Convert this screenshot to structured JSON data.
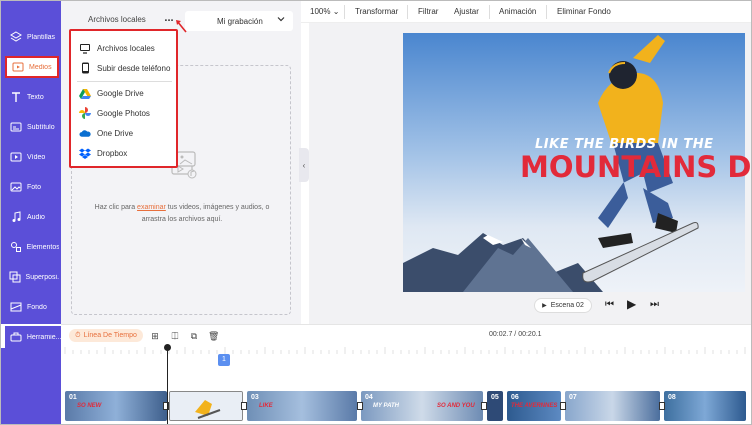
{
  "sidebar": {
    "items": [
      {
        "label": "Plantillas",
        "icon": "layers-icon"
      },
      {
        "label": "Medios",
        "icon": "media-folder-icon",
        "active": true
      },
      {
        "label": "Texto",
        "icon": "text-icon"
      },
      {
        "label": "Subtítulo",
        "icon": "subtitle-icon"
      },
      {
        "label": "Vídeo",
        "icon": "video-icon"
      },
      {
        "label": "Foto",
        "icon": "photo-icon"
      },
      {
        "label": "Audio",
        "icon": "music-icon"
      },
      {
        "label": "Elementos",
        "icon": "elements-icon"
      },
      {
        "label": "Superposi...",
        "icon": "overlay-icon"
      },
      {
        "label": "Fondo",
        "icon": "background-icon"
      },
      {
        "label": "Herramie...",
        "icon": "toolbox-icon"
      }
    ]
  },
  "panel": {
    "tab_label": "Archivos locales",
    "more_label": "...",
    "recording_select": "Mi grabación",
    "drop_text_before": "Haz clic para ",
    "drop_link": "examinar",
    "drop_text_after": " tus videos, imágenes y audios, o arrastra los archivos aquí."
  },
  "upload_menu": {
    "items": [
      {
        "label": "Archivos locales",
        "icon": "monitor-icon"
      },
      {
        "label": "Subir desde teléfono",
        "icon": "phone-icon"
      },
      {
        "label": "Google Drive",
        "icon": "google-drive-icon"
      },
      {
        "label": "Google Photos",
        "icon": "google-photos-icon"
      },
      {
        "label": "One Drive",
        "icon": "onedrive-icon"
      },
      {
        "label": "Dropbox",
        "icon": "dropbox-icon"
      }
    ]
  },
  "toolbar": {
    "zoom": "100%",
    "transform": "Transformar",
    "filter": "Filtrar",
    "adjust": "Ajustar",
    "animation": "Animación",
    "remove_bg": "Eliminar Fondo"
  },
  "preview": {
    "overlay_line1": "LIKE THE BIRDS IN THE",
    "overlay_line2": "MOUNTAINS DO",
    "scene_label": "Escena 02"
  },
  "timeline": {
    "label": "Línea De Tiempo",
    "time": "00:02.7 / 00:20.1",
    "marker": "1",
    "clips": [
      {
        "num": "01",
        "text": "SO NEW"
      },
      {
        "num": "02",
        "text": ""
      },
      {
        "num": "03",
        "text": "LIKE"
      },
      {
        "num": "04",
        "text": "MY PATH"
      },
      {
        "num": "05",
        "text": "SO AND YOU"
      },
      {
        "num": "06",
        "text": "THE AVERNNES"
      },
      {
        "num": "07",
        "text": ""
      },
      {
        "num": "08",
        "text": ""
      }
    ]
  },
  "colors": {
    "sidebar": "#5b4fd8",
    "highlight": "#e0262a",
    "accent_orange": "#e76f3c",
    "title_red": "#e22a3a"
  }
}
